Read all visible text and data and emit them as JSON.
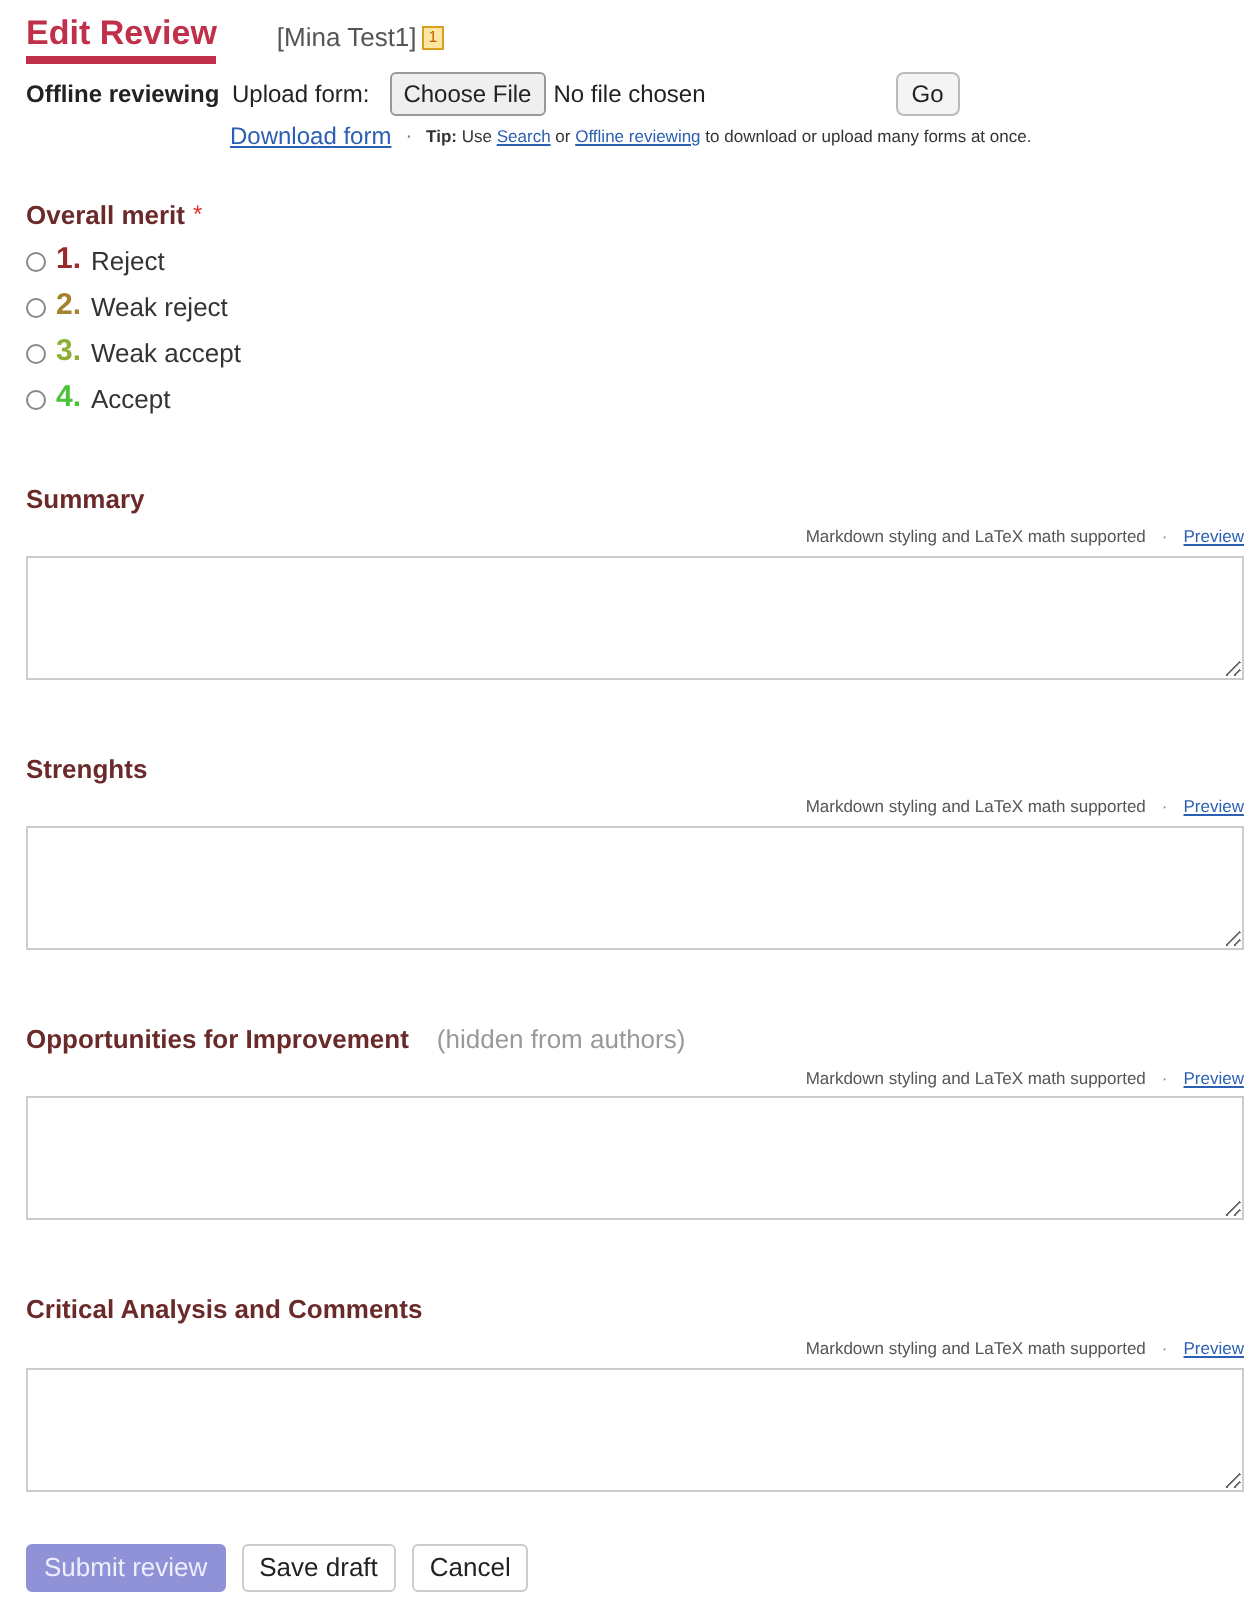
{
  "header": {
    "title": "Edit Review",
    "paper": "[Mina Test1]",
    "badge": "1"
  },
  "offline": {
    "label": "Offline reviewing",
    "upload_label": "Upload form:",
    "choose_button": "Choose File",
    "file_status": "No file chosen",
    "go_button": "Go",
    "download_link": "Download form",
    "separator": "·",
    "tip_label": "Tip:",
    "tip_parts": [
      {
        "kind": "text",
        "text": "Use"
      },
      {
        "kind": "link",
        "text": "Search"
      },
      {
        "kind": "text",
        "text": "or"
      },
      {
        "kind": "link",
        "text": "Offline reviewing"
      },
      {
        "kind": "text",
        "text": "to download or upload many forms at once."
      }
    ]
  },
  "merit": {
    "label": "Overall merit",
    "required_mark": "*",
    "options": [
      {
        "number": "1.",
        "label": "Reject",
        "color": "#9b2b2b",
        "selected": false
      },
      {
        "number": "2.",
        "label": "Weak reject",
        "color": "#a6812e",
        "selected": false
      },
      {
        "number": "3.",
        "label": "Weak accept",
        "color": "#8fae35",
        "selected": false
      },
      {
        "number": "4.",
        "label": "Accept",
        "color": "#4cc23a",
        "selected": false
      }
    ]
  },
  "fields": [
    {
      "label": "Summary",
      "hint": "Markdown styling and LaTeX math supported",
      "separator": "·",
      "preview_link": "Preview"
    },
    {
      "label": "Strenghts",
      "hint": "Markdown styling and LaTeX math supported",
      "separator": "·",
      "preview_link": "Preview"
    },
    {
      "label": "Opportunities for Improvement",
      "note": "(hidden from authors)",
      "hint": "Markdown styling and LaTeX math supported",
      "separator": "·",
      "preview_link": "Preview"
    },
    {
      "label": "Critical Analysis and Comments",
      "hint": "Markdown styling and LaTeX math supported",
      "separator": "·",
      "preview_link": "Preview"
    }
  ],
  "buttons": [
    {
      "kind": "primary",
      "label": "Submit review",
      "disabled": true
    },
    {
      "kind": "secondary",
      "label": "Save draft",
      "disabled": false
    },
    {
      "kind": "secondary",
      "label": "Cancel",
      "disabled": false
    }
  ]
}
